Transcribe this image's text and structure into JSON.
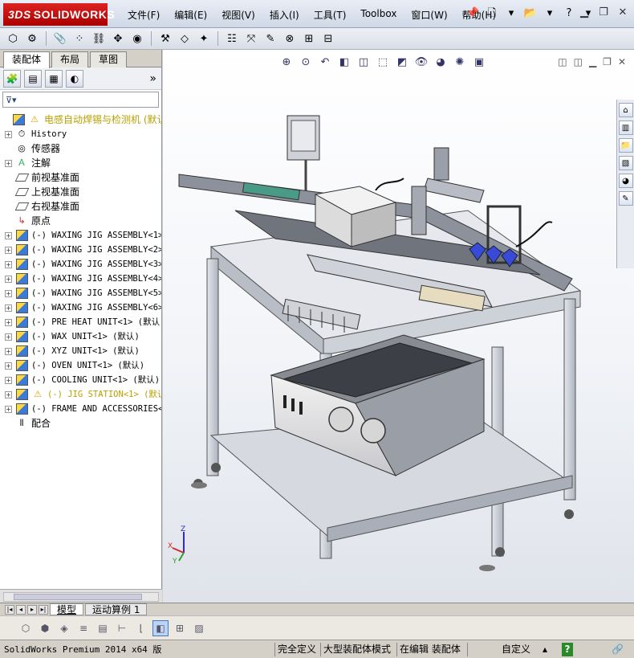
{
  "app": {
    "brand_prefix": "3DS",
    "brand_name": "SOLIDWORKS"
  },
  "menu": [
    "文件(F)",
    "编辑(E)",
    "视图(V)",
    "插入(I)",
    "工具(T)",
    "Toolbox",
    "窗口(W)",
    "帮助(H)"
  ],
  "left_panel": {
    "tabs": [
      "装配体",
      "布局",
      "草图"
    ],
    "active_tab": "装配体",
    "more_glyph": "»",
    "tree": [
      {
        "label": "电感自动焊锡与检测机  (默认",
        "icon": "assembly-icon",
        "warn": true,
        "root": true
      },
      {
        "label": "History",
        "icon": "history-icon",
        "expandable": true
      },
      {
        "label": "传感器",
        "icon": "sensor-icon"
      },
      {
        "label": "注解",
        "icon": "annotation-icon",
        "expandable": true
      },
      {
        "label": "前视基准面",
        "icon": "plane-icon"
      },
      {
        "label": "上视基准面",
        "icon": "plane-icon"
      },
      {
        "label": "右视基准面",
        "icon": "plane-icon"
      },
      {
        "label": "原点",
        "icon": "origin-icon"
      },
      {
        "label": "(-) WAXING JIG ASSEMBLY<1>",
        "icon": "assembly-icon",
        "expandable": true
      },
      {
        "label": "(-) WAXING JIG ASSEMBLY<2>",
        "icon": "assembly-icon",
        "expandable": true
      },
      {
        "label": "(-) WAXING JIG ASSEMBLY<3>",
        "icon": "assembly-icon",
        "expandable": true
      },
      {
        "label": "(-) WAXING JIG ASSEMBLY<4>",
        "icon": "assembly-icon",
        "expandable": true
      },
      {
        "label": "(-) WAXING JIG ASSEMBLY<5>",
        "icon": "assembly-icon",
        "expandable": true
      },
      {
        "label": "(-) WAXING JIG ASSEMBLY<6>",
        "icon": "assembly-icon",
        "expandable": true
      },
      {
        "label": "(-) PRE HEAT UNIT<1> (默认",
        "icon": "assembly-icon",
        "expandable": true
      },
      {
        "label": "(-) WAX UNIT<1> (默认)",
        "icon": "assembly-icon",
        "expandable": true
      },
      {
        "label": "(-) XYZ UNIT<1> (默认)",
        "icon": "assembly-icon",
        "expandable": true
      },
      {
        "label": "(-) OVEN UNIT<1> (默认)",
        "icon": "assembly-icon",
        "expandable": true
      },
      {
        "label": "(-) COOLING UNIT<1> (默认)",
        "icon": "assembly-icon",
        "expandable": true
      },
      {
        "label": "(-) JIG STATION<1> (默认",
        "icon": "assembly-icon",
        "expandable": true,
        "warn": true
      },
      {
        "label": "(-) FRAME AND ACCESSORIES<",
        "icon": "assembly-icon",
        "expandable": true
      },
      {
        "label": "配合",
        "icon": "mates-icon"
      }
    ]
  },
  "bottom_tabs": [
    "模型",
    "运动算例 1"
  ],
  "status": {
    "version": "SolidWorks Premium 2014 x64 版",
    "fully_defined": "完全定义",
    "large_assembly": "大型装配体模式",
    "editing": "在编辑 装配体",
    "custom": "自定义",
    "help": "?"
  },
  "triad": {
    "x": "X",
    "y": "Y",
    "z": "Z"
  },
  "colors": {
    "accent": "#3a7ad8",
    "warn": "#d8a400",
    "brand": "#c41a1a",
    "frame": "#c8cbd2"
  }
}
